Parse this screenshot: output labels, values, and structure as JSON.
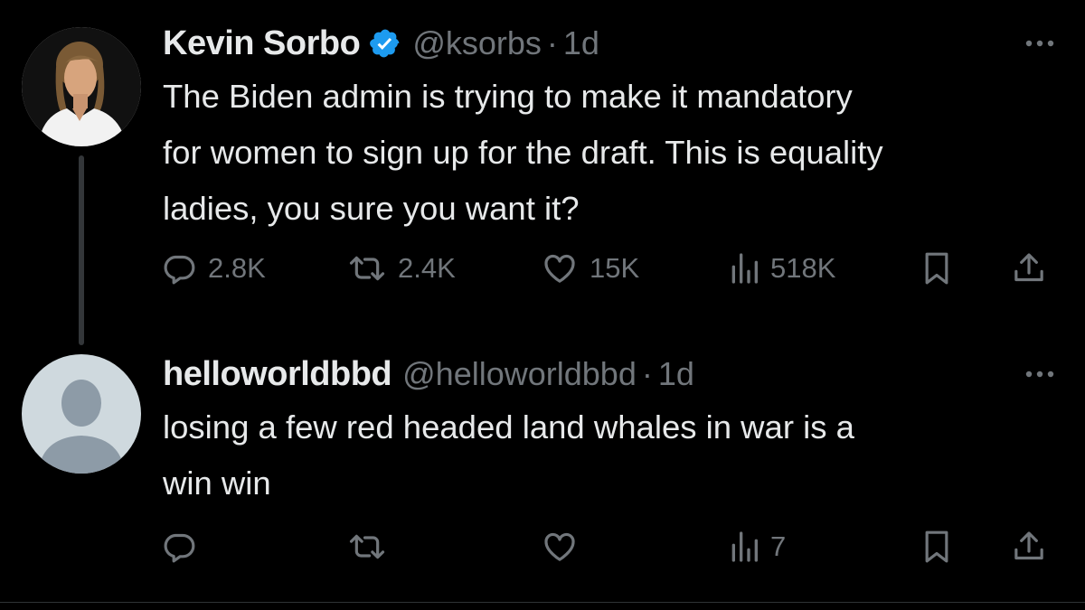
{
  "tweets": [
    {
      "display_name": "Kevin Sorbo",
      "verified": true,
      "handle": "@ksorbs",
      "separator": "·",
      "time": "1d",
      "text": "The Biden admin is trying to make it mandatory\nfor women to sign up for the draft. This is equality\nladies, you sure you want it?",
      "avatar_icon": "profile-photo",
      "counts": {
        "replies": "2.8K",
        "retweets": "2.4K",
        "likes": "15K",
        "views": "518K"
      }
    },
    {
      "display_name": "helloworldbbd",
      "verified": false,
      "handle": "@helloworldbbd",
      "separator": "·",
      "time": "1d",
      "text": "losing a few red headed land whales in war is a\nwin win",
      "avatar_icon": "default-avatar-icon",
      "counts": {
        "replies": "",
        "retweets": "",
        "likes": "",
        "views": "7"
      }
    }
  ],
  "icons": {
    "reply": "reply-icon",
    "retweet": "retweet-icon",
    "like": "heart-icon",
    "views": "views-icon",
    "bookmark": "bookmark-icon",
    "share": "share-icon",
    "more": "more-icon",
    "verified": "verified-badge-icon"
  },
  "colors": {
    "background": "#000000",
    "text": "#e7e9ea",
    "secondary": "#71767b",
    "verified_blue": "#1d9bf0",
    "thread_line": "#333639"
  }
}
